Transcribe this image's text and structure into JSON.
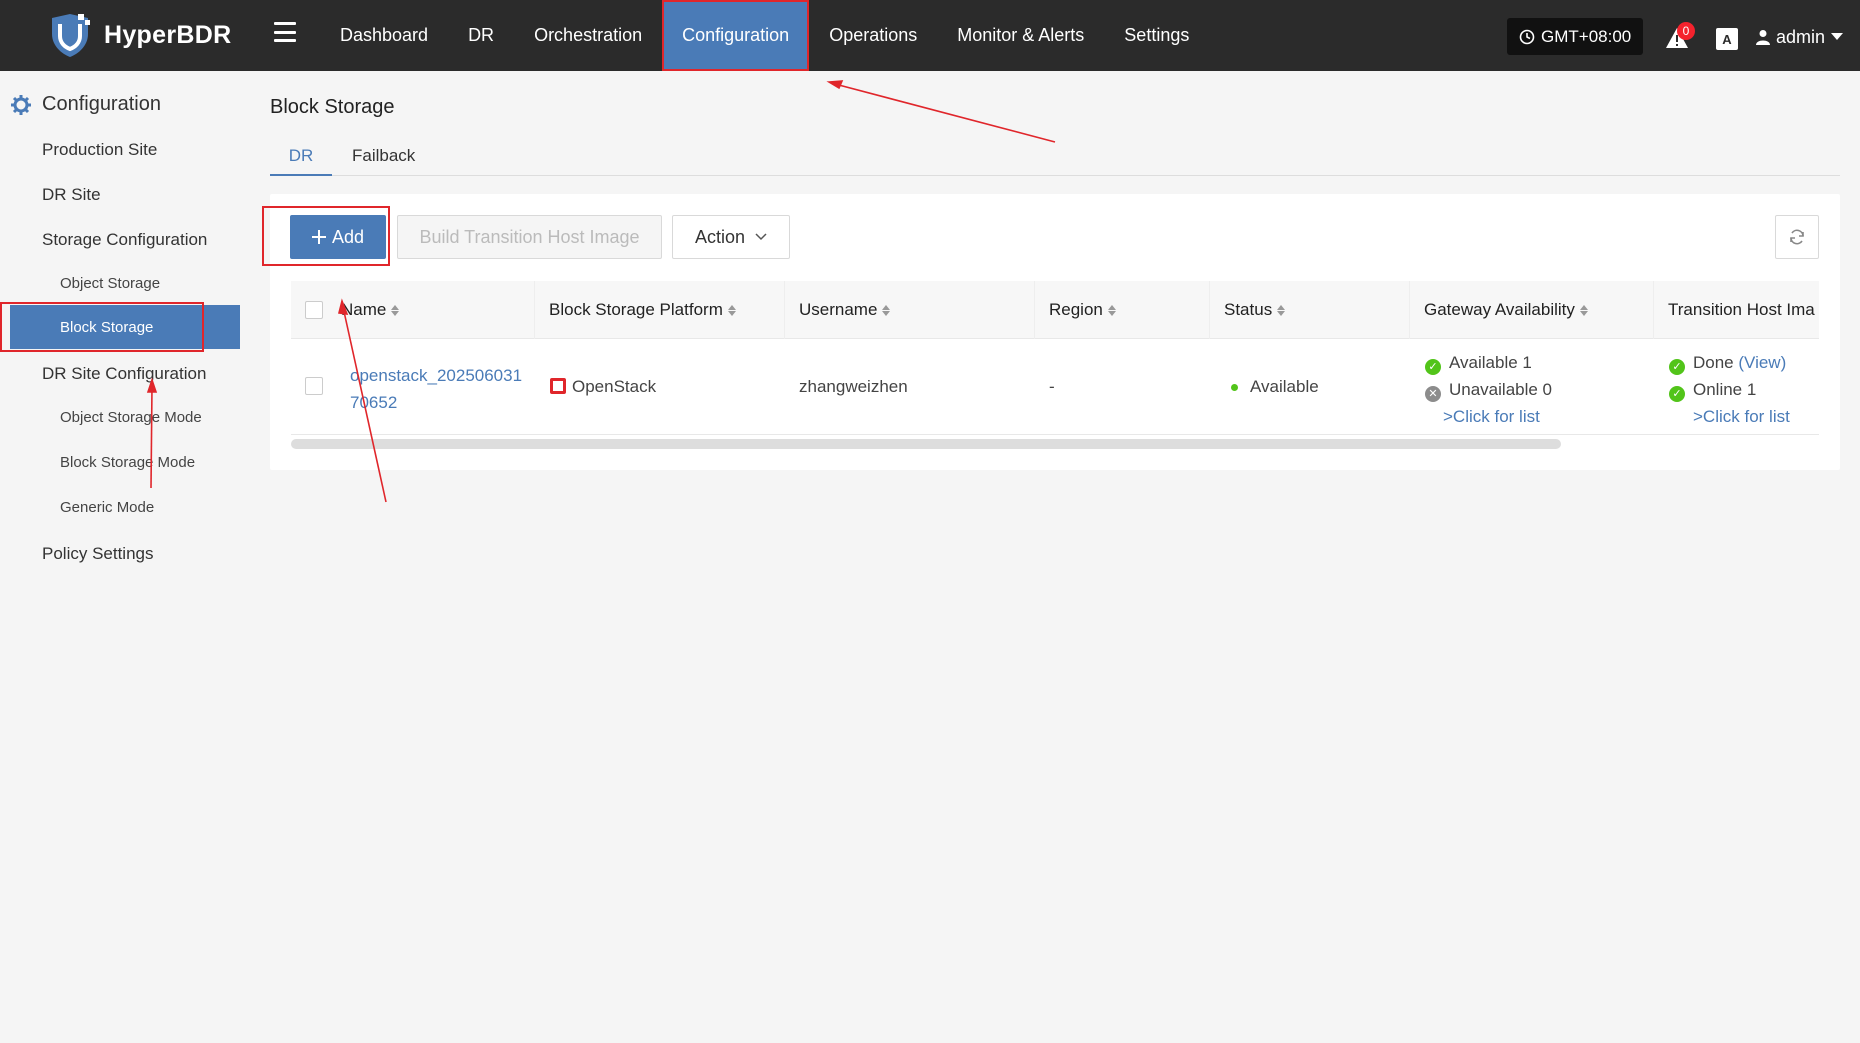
{
  "app": {
    "name": "HyperBDR"
  },
  "topnav": {
    "items": [
      "Dashboard",
      "DR",
      "Orchestration",
      "Configuration",
      "Operations",
      "Monitor & Alerts",
      "Settings"
    ],
    "active": "Configuration"
  },
  "header": {
    "timezone": "GMT+08:00",
    "alert_count": "0",
    "lang_label": "A",
    "user": "admin"
  },
  "sidebar": {
    "title": "Configuration",
    "production_site": "Production Site",
    "dr_site": "DR Site",
    "storage_configuration": "Storage Configuration",
    "object_storage": "Object Storage",
    "block_storage": "Block Storage",
    "dr_site_configuration": "DR Site Configuration",
    "object_storage_mode": "Object Storage Mode",
    "block_storage_mode": "Block Storage Mode",
    "generic_mode": "Generic Mode",
    "policy_settings": "Policy Settings"
  },
  "page": {
    "title": "Block Storage"
  },
  "tabs": {
    "dr": "DR",
    "failback": "Failback"
  },
  "toolbar": {
    "add": "Add",
    "build": "Build Transition Host Image",
    "action": "Action"
  },
  "table": {
    "columns": {
      "name": "Name",
      "platform": "Block Storage Platform",
      "username": "Username",
      "region": "Region",
      "status": "Status",
      "gateway": "Gateway Availability",
      "transition": "Transition Host Ima"
    },
    "rows": [
      {
        "name_line1": "openstack_202506031",
        "name_line2": "70652",
        "platform": "OpenStack",
        "username": "zhangweizhen",
        "region": "-",
        "status": "Available",
        "gateway_available": "Available 1",
        "gateway_unavailable": "Unavailable 0",
        "gateway_link": ">Click for list",
        "transition_done": "Done",
        "transition_view": "(View)",
        "transition_online": "Online 1",
        "transition_link": ">Click for list"
      }
    ]
  },
  "colors": {
    "accent": "#4a7bb7",
    "topbar": "#2b2b2b",
    "annotation": "#e0262b",
    "success": "#52c41a"
  }
}
